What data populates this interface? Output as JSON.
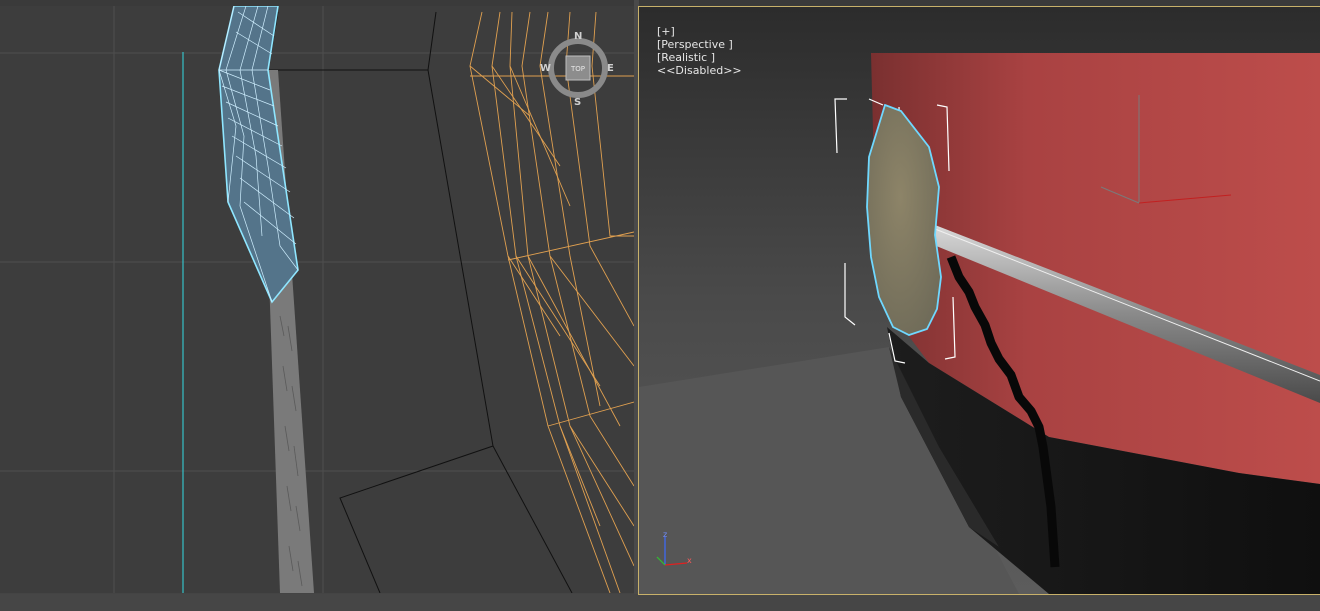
{
  "viewports": {
    "top": {
      "viewcube": {
        "face_label": "TOP",
        "north": "N",
        "south": "S",
        "west": "W",
        "east": "E"
      }
    },
    "perspective": {
      "label_plus": "[+]",
      "label_view": "[Perspective ]",
      "label_shading": "[Realistic ]",
      "label_status": "<<Disabled>>",
      "axis_z": "z",
      "axis_x": "x"
    }
  },
  "colors": {
    "active_border": "#c8b16a",
    "selection": "#7fe3ff",
    "wire_orange": "#e0a050",
    "hull_red": "#b84a48"
  }
}
